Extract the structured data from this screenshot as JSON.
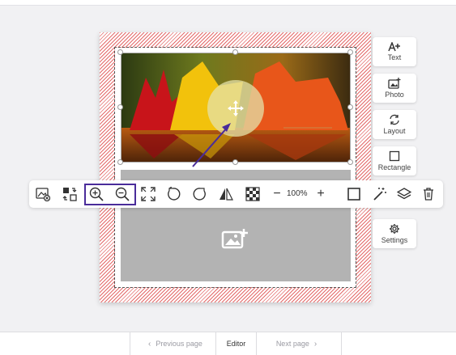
{
  "bottom_nav": {
    "previous_label": "Previous page",
    "editor_label": "Editor",
    "next_label": "Next page"
  },
  "side_panel": {
    "text_label": "Text",
    "photo_label": "Photo",
    "layout_label": "Layout",
    "rectangle_label": "Rectangle",
    "settings_label": "Settings"
  },
  "toolbar": {
    "zoom_level": "100%",
    "zoom_minus": "−",
    "zoom_plus": "+",
    "icons": [
      "image-remove-icon",
      "swap-icon",
      "zoom-in-icon",
      "zoom-out-icon",
      "fit-icon",
      "rotate-left-icon",
      "rotate-right-icon",
      "flip-icon",
      "transparency-icon",
      "border-icon",
      "magic-wand-icon",
      "layers-icon",
      "trash-icon"
    ]
  },
  "colors": {
    "accent": "#4a2c9a",
    "page_stripe": "#e36a6a",
    "placeholder_gray": "#b3b3b3"
  }
}
